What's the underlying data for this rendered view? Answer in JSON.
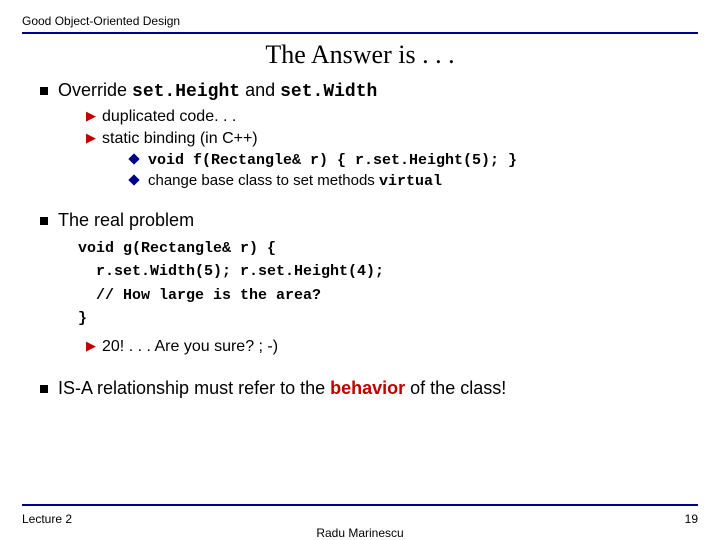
{
  "header": {
    "label": "Good Object-Oriented Design"
  },
  "title": "The Answer is . . .",
  "s1": {
    "pre": "Override ",
    "m1": "set.Height",
    "mid": " and ",
    "m2": "set.Width",
    "b1": "duplicated code. . .",
    "b2": "static binding (in C++)",
    "c1": "void f(Rectangle& r) { r.set.Height(5); }",
    "c2a": "change base class to set methods ",
    "c2b": "virtual"
  },
  "s2": {
    "h": "The real problem",
    "code": "void g(Rectangle& r) {\n  r.set.Width(5); r.set.Height(4);\n  // How large is the area?\n}",
    "ans": "20! . . . Are you sure? ; -)"
  },
  "s3": {
    "pre": "IS-A relationship must refer to the ",
    "emph": "behavior",
    "post": " of the class!"
  },
  "footer": {
    "left": "Lecture 2",
    "center": "Radu Marinescu",
    "right": "19"
  }
}
